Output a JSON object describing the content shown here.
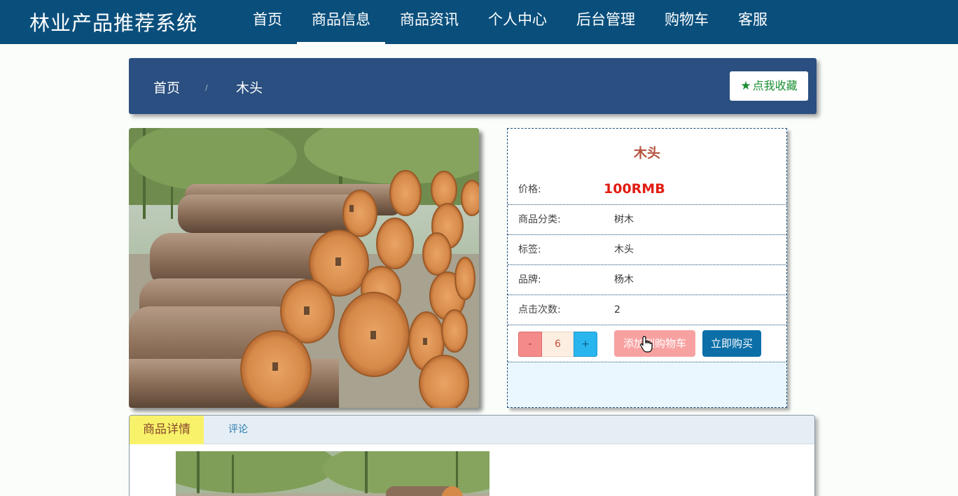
{
  "brand": "林业产品推荐系统",
  "nav": [
    "首页",
    "商品信息",
    "商品资讯",
    "个人中心",
    "后台管理",
    "购物车",
    "客服"
  ],
  "breadcrumb": {
    "home": "首页",
    "sep": "/",
    "current": "木头"
  },
  "favorite_label": "点我收藏",
  "product": {
    "name": "木头",
    "price_label": "价格:",
    "price": "100RMB",
    "fields": [
      {
        "label": "商品分类:",
        "value": "树木"
      },
      {
        "label": "标签:",
        "value": "木头"
      },
      {
        "label": "品牌:",
        "value": "杨木"
      },
      {
        "label": "点击次数:",
        "value": "2"
      }
    ]
  },
  "purchase": {
    "minus": "-",
    "quantity": "6",
    "plus": "+",
    "add_cart": "添加到购物车",
    "buy_now": "立即购买"
  },
  "tabs": {
    "detail": "商品详情",
    "comment": "评论"
  },
  "colors": {
    "navbar": "#0a4f7c",
    "crumbbar": "#2a4f80",
    "price": "#e11c12"
  }
}
